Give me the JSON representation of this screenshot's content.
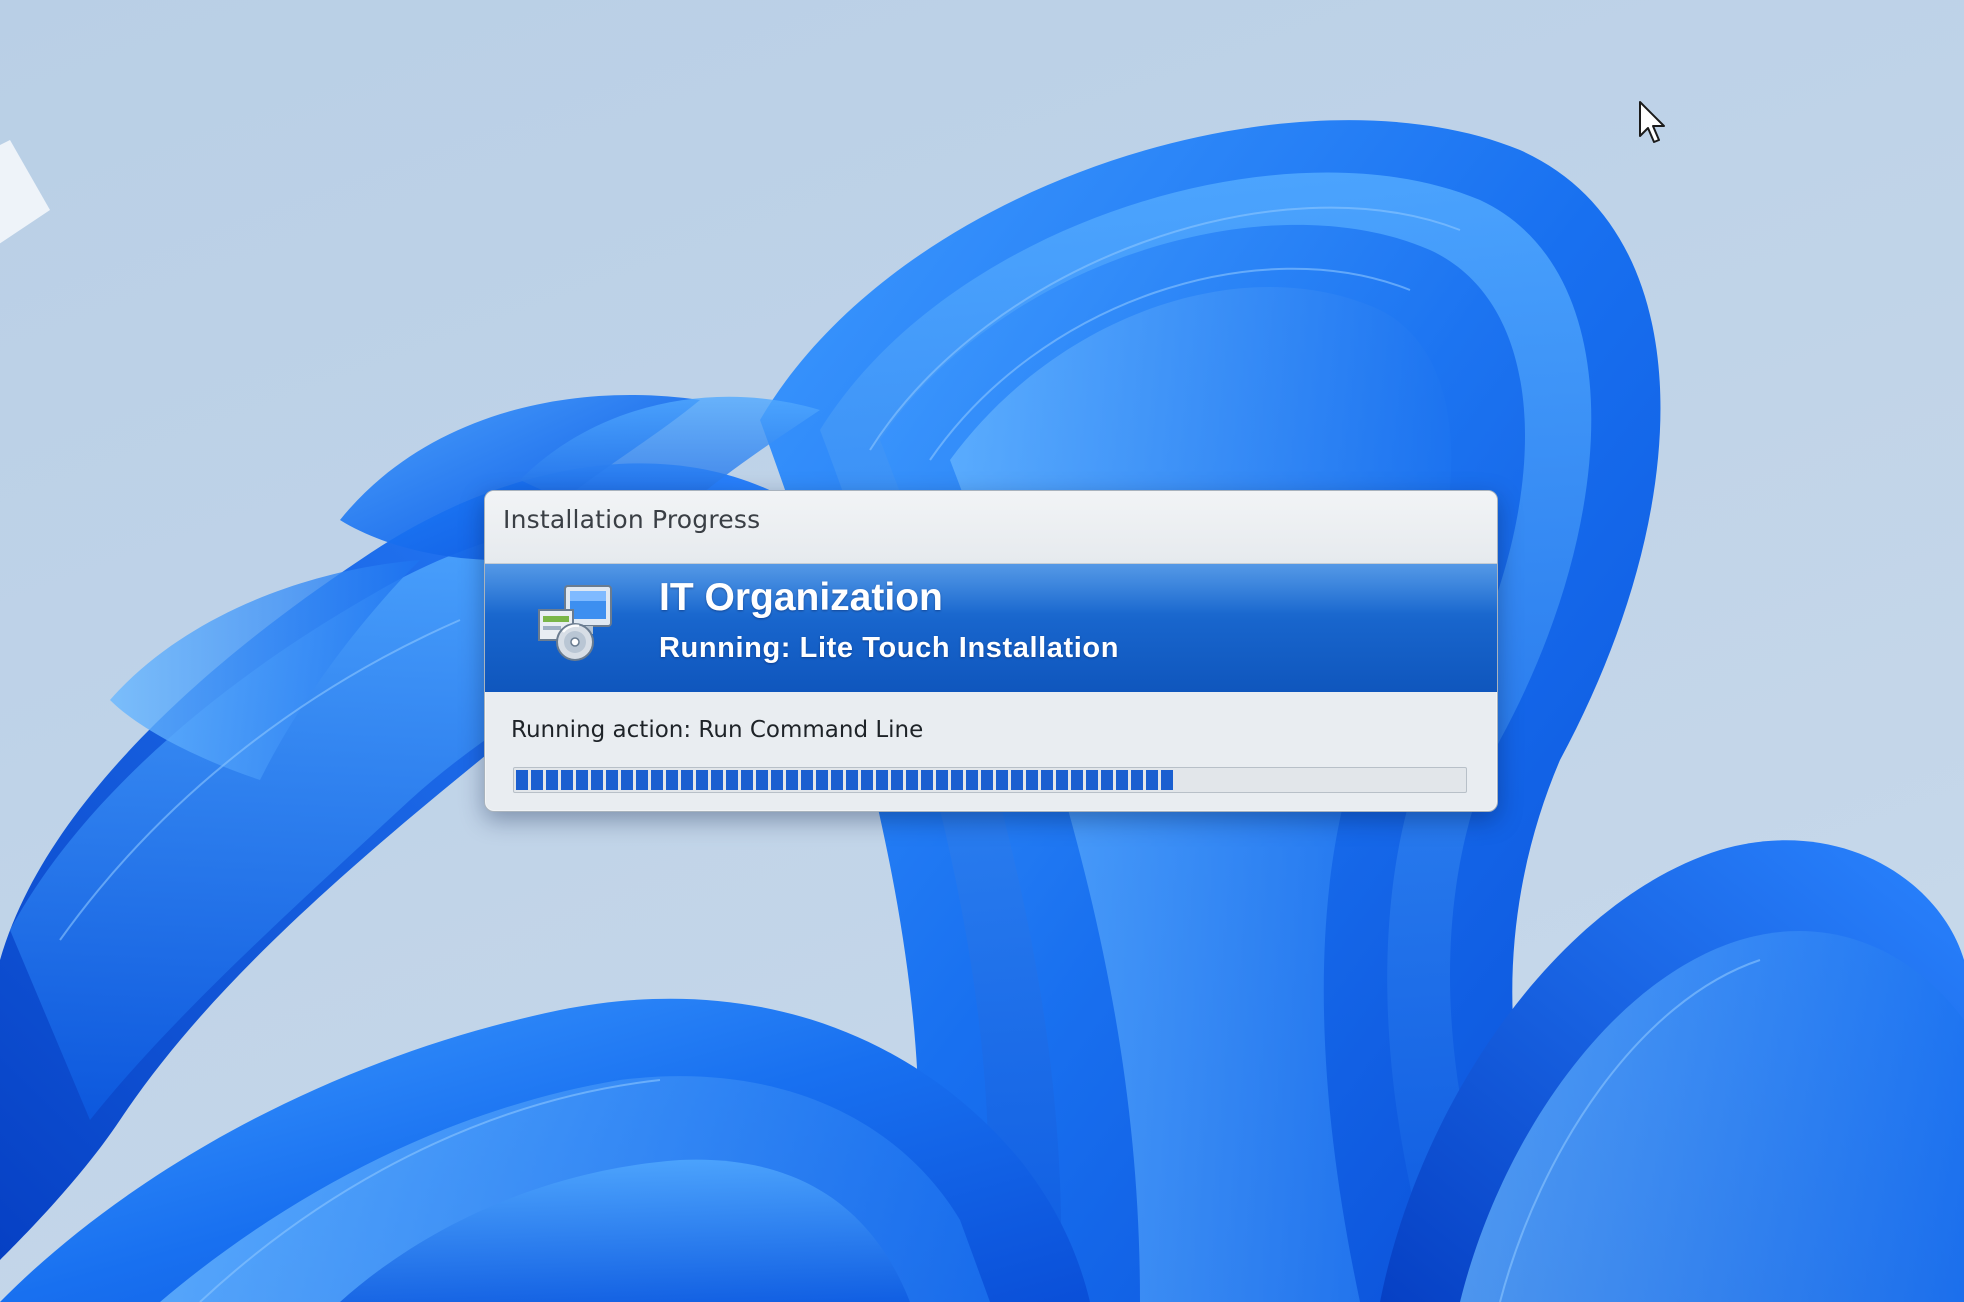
{
  "dialog": {
    "title": "Installation Progress",
    "organization": "IT Organization",
    "status": "Running: Lite Touch Installation",
    "action": "Running action: Run Command Line",
    "progress": 0.7,
    "icon": "computer-install-icon"
  },
  "colors": {
    "banner_blue": "#1865cc",
    "progress_blue": "#1a5fd0",
    "dialog_background": "#e9edf1",
    "desktop_background": "#bfd3e8",
    "wallpaper_blue": "#1a6ff0"
  },
  "desktop": {
    "wallpaper": "windows-11-bloom",
    "cursor": "arrow-cursor-icon"
  }
}
